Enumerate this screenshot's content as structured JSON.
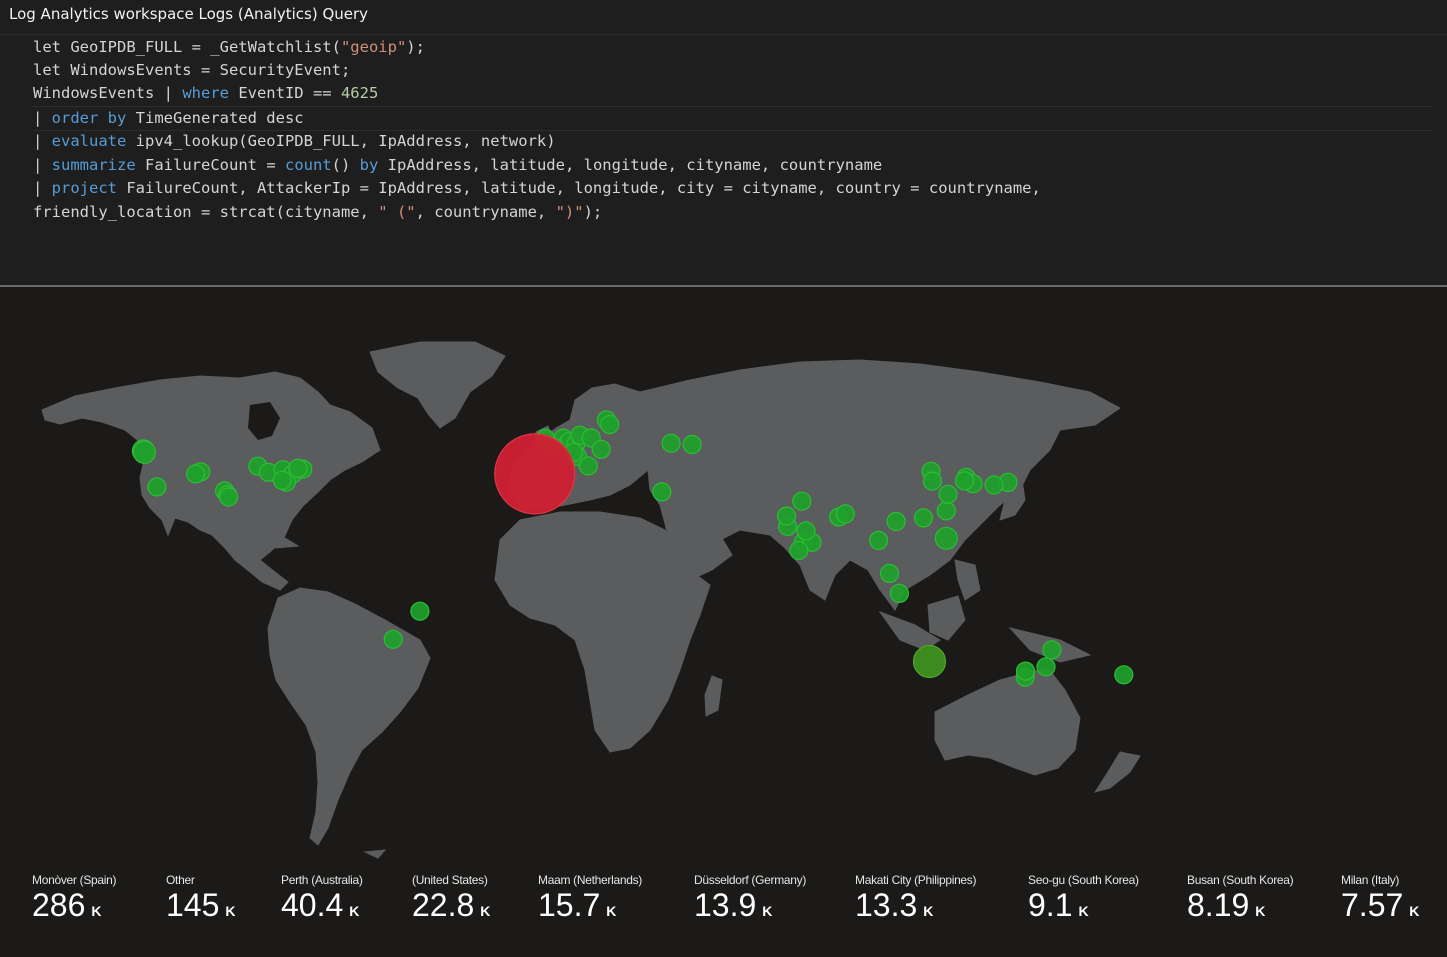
{
  "window": {
    "title": "Log Analytics workspace Logs (Analytics) Query"
  },
  "query": {
    "lines": [
      [
        {
          "t": "let GeoIPDB_FULL = _GetWatchlist("
        },
        {
          "t": "\"geoip\"",
          "c": "str"
        },
        {
          "t": ");"
        }
      ],
      [
        {
          "t": "let WindowsEvents = SecurityEvent;"
        }
      ],
      [
        {
          "t": "WindowsEvents | "
        },
        {
          "t": "where",
          "c": "kw"
        },
        {
          "t": " EventID == "
        },
        {
          "t": "4625",
          "c": "num"
        }
      ],
      [
        {
          "t": "| ",
          "c": "pipe"
        },
        {
          "t": "order by",
          "c": "kw"
        },
        {
          "t": " TimeGenerated desc"
        }
      ],
      [
        {
          "t": "| ",
          "c": "pipe"
        },
        {
          "t": "evaluate",
          "c": "kw"
        },
        {
          "t": " ipv4_lookup(GeoIPDB_FULL, IpAddress, network)"
        }
      ],
      [
        {
          "t": "| ",
          "c": "pipe"
        },
        {
          "t": "summarize",
          "c": "kw"
        },
        {
          "t": " FailureCount = "
        },
        {
          "t": "count",
          "c": "kw"
        },
        {
          "t": "() "
        },
        {
          "t": "by",
          "c": "kw"
        },
        {
          "t": " IpAddress, latitude, longitude, cityname, countryname"
        }
      ],
      [
        {
          "t": "| ",
          "c": "pipe"
        },
        {
          "t": "project",
          "c": "kw"
        },
        {
          "t": " FailureCount, AttackerIp = IpAddress, latitude, longitude, city = cityname, country = countryname,"
        }
      ],
      [
        {
          "t": "friendly_location = strcat(cityname, "
        },
        {
          "t": "\" (\"",
          "c": "str"
        },
        {
          "t": ", countryname, "
        },
        {
          "t": "\")\"",
          "c": "str"
        },
        {
          "t": ");"
        }
      ]
    ]
  },
  "map": {
    "colors": {
      "land": "#5b5c5e",
      "background": "#1b1a19",
      "point": "#1fa12b",
      "point_stroke": "#2cbd35",
      "hot": "#d11f33",
      "hot_stroke": "#e13645",
      "large_point": "#3d8a1e"
    },
    "points": [
      {
        "lon": -3.7,
        "lat": 38.9,
        "size": "huge",
        "color": "hot"
      },
      {
        "lon": 115.9,
        "lat": -31.9,
        "size": "large",
        "color": "large_point"
      },
      {
        "lon": -122.3,
        "lat": 47.6,
        "size": "med"
      },
      {
        "lon": -122.0,
        "lat": 47.0,
        "size": "med"
      },
      {
        "lon": -118.2,
        "lat": 34.0,
        "size": "sm"
      },
      {
        "lon": -104.9,
        "lat": 39.7,
        "size": "sm"
      },
      {
        "lon": -106.5,
        "lat": 38.9,
        "size": "sm"
      },
      {
        "lon": -97.7,
        "lat": 32.5,
        "size": "sm"
      },
      {
        "lon": -96.8,
        "lat": 31.0,
        "size": "sm"
      },
      {
        "lon": -96.5,
        "lat": 30.2,
        "size": "sm"
      },
      {
        "lon": -87.6,
        "lat": 41.8,
        "size": "sm"
      },
      {
        "lon": -84.4,
        "lat": 39.5,
        "size": "sm"
      },
      {
        "lon": -80.0,
        "lat": 40.4,
        "size": "sm"
      },
      {
        "lon": -77.0,
        "lat": 38.9,
        "size": "sm"
      },
      {
        "lon": -74.0,
        "lat": 40.7,
        "size": "sm"
      },
      {
        "lon": -75.5,
        "lat": 41.0,
        "size": "sm"
      },
      {
        "lon": -79.0,
        "lat": 35.8,
        "size": "sm"
      },
      {
        "lon": -80.2,
        "lat": 36.5,
        "size": "sm"
      },
      {
        "lon": -38.5,
        "lat": -12.9,
        "size": "sm"
      },
      {
        "lon": -46.6,
        "lat": -23.5,
        "size": "sm"
      },
      {
        "lon": -0.1,
        "lat": 51.5,
        "size": "sm"
      },
      {
        "lon": -0.5,
        "lat": 52.3,
        "size": "sm"
      },
      {
        "lon": 4.9,
        "lat": 52.4,
        "size": "sm"
      },
      {
        "lon": 6.8,
        "lat": 51.2,
        "size": "sm"
      },
      {
        "lon": 8.7,
        "lat": 50.1,
        "size": "sm"
      },
      {
        "lon": 10.0,
        "lat": 53.5,
        "size": "sm"
      },
      {
        "lon": 13.4,
        "lat": 52.5,
        "size": "sm"
      },
      {
        "lon": 2.3,
        "lat": 48.9,
        "size": "sm"
      },
      {
        "lon": 9.2,
        "lat": 45.5,
        "size": "sm"
      },
      {
        "lon": 8.0,
        "lat": 47.0,
        "size": "sm"
      },
      {
        "lon": 18.0,
        "lat": 59.3,
        "size": "sm"
      },
      {
        "lon": 19.0,
        "lat": 57.5,
        "size": "sm"
      },
      {
        "lon": 16.4,
        "lat": 48.2,
        "size": "sm"
      },
      {
        "lon": 37.6,
        "lat": 50.5,
        "size": "sm"
      },
      {
        "lon": 44.0,
        "lat": 50.0,
        "size": "sm"
      },
      {
        "lon": 12.5,
        "lat": 41.9,
        "size": "sm"
      },
      {
        "lon": 34.8,
        "lat": 32.1,
        "size": "sm"
      },
      {
        "lon": 72.9,
        "lat": 19.1,
        "size": "sm"
      },
      {
        "lon": 72.6,
        "lat": 23.0,
        "size": "sm"
      },
      {
        "lon": 77.2,
        "lat": 28.6,
        "size": "sm"
      },
      {
        "lon": 77.6,
        "lat": 13.0,
        "size": "sm"
      },
      {
        "lon": 80.3,
        "lat": 13.1,
        "size": "sm"
      },
      {
        "lon": 78.5,
        "lat": 17.4,
        "size": "sm"
      },
      {
        "lon": 76.3,
        "lat": 10.0,
        "size": "sm"
      },
      {
        "lon": 88.4,
        "lat": 22.6,
        "size": "sm"
      },
      {
        "lon": 90.4,
        "lat": 23.8,
        "size": "sm"
      },
      {
        "lon": 100.5,
        "lat": 13.8,
        "size": "sm"
      },
      {
        "lon": 105.8,
        "lat": 21.0,
        "size": "sm"
      },
      {
        "lon": 103.8,
        "lat": 1.35,
        "size": "sm"
      },
      {
        "lon": 106.8,
        "lat": -6.2,
        "size": "sm"
      },
      {
        "lon": 114.1,
        "lat": 22.3,
        "size": "sm"
      },
      {
        "lon": 121.0,
        "lat": 14.6,
        "size": "med"
      },
      {
        "lon": 121.0,
        "lat": 25.0,
        "size": "sm"
      },
      {
        "lon": 116.4,
        "lat": 39.9,
        "size": "sm"
      },
      {
        "lon": 116.8,
        "lat": 36.2,
        "size": "sm"
      },
      {
        "lon": 121.5,
        "lat": 31.2,
        "size": "sm"
      },
      {
        "lon": 127.0,
        "lat": 37.6,
        "size": "sm"
      },
      {
        "lon": 129.1,
        "lat": 35.2,
        "size": "sm"
      },
      {
        "lon": 126.5,
        "lat": 36.3,
        "size": "sm"
      },
      {
        "lon": 139.7,
        "lat": 35.7,
        "size": "sm"
      },
      {
        "lon": 135.5,
        "lat": 34.7,
        "size": "sm"
      },
      {
        "lon": 151.2,
        "lat": -33.9,
        "size": "sm"
      },
      {
        "lon": 153.0,
        "lat": -27.5,
        "size": "sm"
      },
      {
        "lon": 144.9,
        "lat": -37.8,
        "size": "sm"
      },
      {
        "lon": 145.0,
        "lat": -35.5,
        "size": "sm"
      },
      {
        "lon": 174.8,
        "lat": -36.9,
        "size": "sm"
      }
    ]
  },
  "stats": [
    {
      "label": "Monòver (Spain)",
      "value": "286",
      "unit": "K"
    },
    {
      "label": "Other",
      "value": "145",
      "unit": "K"
    },
    {
      "label": "Perth (Australia)",
      "value": "40.4",
      "unit": "K"
    },
    {
      "label": "(United States)",
      "value": "22.8",
      "unit": "K"
    },
    {
      "label": "Maam (Netherlands)",
      "value": "15.7",
      "unit": "K"
    },
    {
      "label": "Düsseldorf (Germany)",
      "value": "13.9",
      "unit": "K"
    },
    {
      "label": "Makati City (Philippines)",
      "value": "13.3",
      "unit": "K"
    },
    {
      "label": "Seo-gu (South Korea)",
      "value": "9.1",
      "unit": "K"
    },
    {
      "label": "Busan (South Korea)",
      "value": "8.19",
      "unit": "K"
    },
    {
      "label": "Milan (Italy)",
      "value": "7.57",
      "unit": "K"
    }
  ]
}
